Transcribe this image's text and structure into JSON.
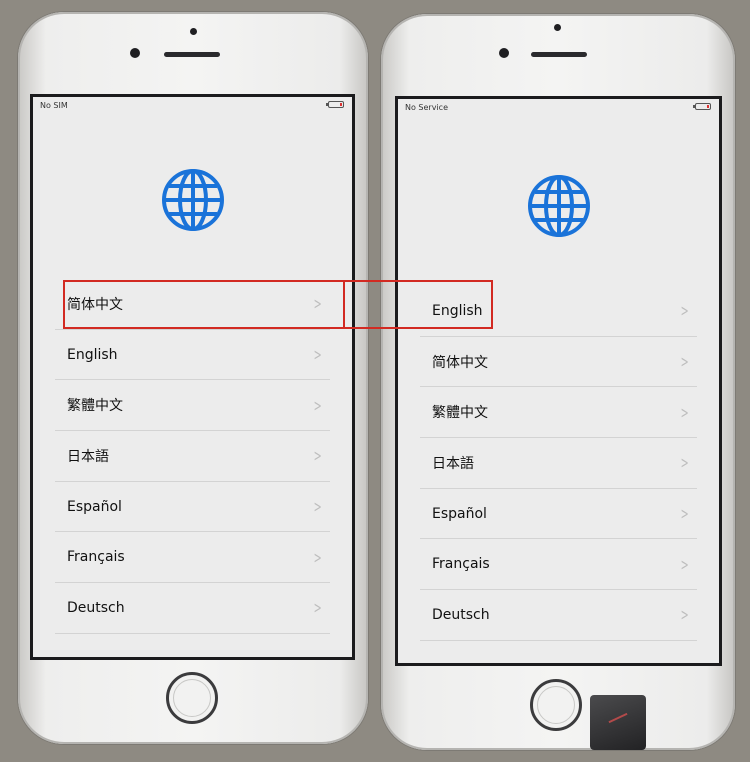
{
  "left_phone": {
    "status_carrier": "No SIM",
    "languages": [
      {
        "label": "简体中文",
        "highlighted": true
      },
      {
        "label": "English"
      },
      {
        "label": "繁體中文"
      },
      {
        "label": "日本語"
      },
      {
        "label": "Español"
      },
      {
        "label": "Français"
      },
      {
        "label": "Deutsch"
      }
    ]
  },
  "right_phone": {
    "status_carrier": "No Service",
    "languages": [
      {
        "label": "English",
        "highlighted": true
      },
      {
        "label": "简体中文"
      },
      {
        "label": "繁體中文"
      },
      {
        "label": "日本語"
      },
      {
        "label": "Español"
      },
      {
        "label": "Français"
      },
      {
        "label": "Deutsch"
      }
    ]
  },
  "icons": {
    "globe": "globe-icon",
    "chevron": "chevron-right-icon"
  },
  "colors": {
    "globe_blue": "#1a73d9",
    "highlight_red": "#d22a22",
    "screen_bg": "#ececec"
  }
}
